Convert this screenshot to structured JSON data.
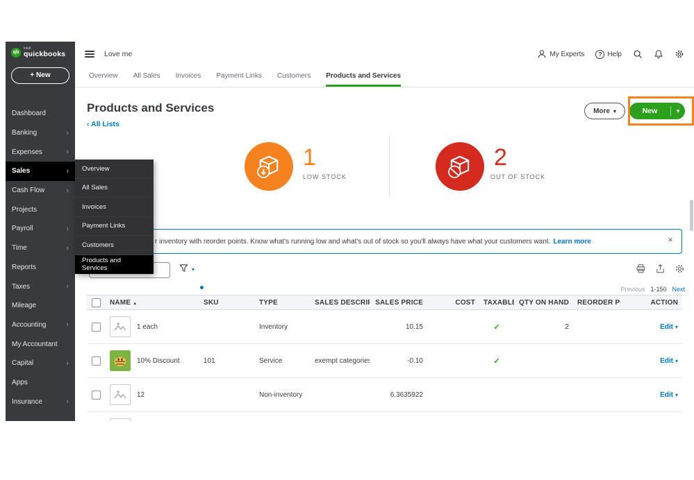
{
  "icons": {
    "chevron_right": "›",
    "back_chevron": "‹",
    "caret_down": "▾",
    "sort_asc": "▲",
    "check": "✓",
    "close": "×",
    "plus": "+"
  },
  "brand": {
    "logo_intuit": "intuit",
    "logo_name": "quickbooks",
    "logo_initials": "qb",
    "green": "#2CA01C"
  },
  "topbar": {
    "company": "Love me",
    "my_experts": "My Experts",
    "help": "Help"
  },
  "sidebar": {
    "new_button": "New",
    "items": [
      {
        "label": "Dashboard",
        "chevron": false,
        "active": false
      },
      {
        "label": "Banking",
        "chevron": true,
        "active": false
      },
      {
        "label": "Expenses",
        "chevron": true,
        "active": false
      },
      {
        "label": "Sales",
        "chevron": true,
        "active": true
      },
      {
        "label": "Cash Flow",
        "chevron": true,
        "active": false
      },
      {
        "label": "Projects",
        "chevron": false,
        "active": false
      },
      {
        "label": "Payroll",
        "chevron": true,
        "active": false
      },
      {
        "label": "Time",
        "chevron": true,
        "active": false
      },
      {
        "label": "Reports",
        "chevron": false,
        "active": false
      },
      {
        "label": "Taxes",
        "chevron": true,
        "active": false
      },
      {
        "label": "Mileage",
        "chevron": false,
        "active": false
      },
      {
        "label": "Accounting",
        "chevron": true,
        "active": false
      },
      {
        "label": "My Accountant",
        "chevron": false,
        "active": false
      },
      {
        "label": "Capital",
        "chevron": true,
        "active": false
      },
      {
        "label": "Apps",
        "chevron": false,
        "active": false
      },
      {
        "label": "Insurance",
        "chevron": true,
        "active": false
      }
    ]
  },
  "flyout": {
    "items": [
      {
        "label": "Overview",
        "active": false
      },
      {
        "label": "All Sales",
        "active": false
      },
      {
        "label": "Invoices",
        "active": false
      },
      {
        "label": "Payment Links",
        "active": false
      },
      {
        "label": "Customers",
        "active": false
      },
      {
        "label": "Products and Services",
        "active": true
      }
    ]
  },
  "tabs": [
    {
      "label": "Overview",
      "active": false
    },
    {
      "label": "All Sales",
      "active": false
    },
    {
      "label": "Invoices",
      "active": false
    },
    {
      "label": "Payment Links",
      "active": false
    },
    {
      "label": "Customers",
      "active": false
    },
    {
      "label": "Products and Services",
      "active": true
    }
  ],
  "page": {
    "title": "Products and Services",
    "back_link": "All Lists",
    "more_button": "More",
    "new_button": "New"
  },
  "stats": [
    {
      "value": "1",
      "label": "LOW STOCK",
      "color": "#F6821F"
    },
    {
      "value": "2",
      "label": "OUT OF STOCK",
      "color": "#D52B1E"
    }
  ],
  "banner": {
    "text": "r inventory with reorder points. Know what's running low and what's out of stock so you'll always have what your customers want.",
    "link": "Learn more"
  },
  "search": {
    "value": ""
  },
  "pagination": {
    "previous": "Previous",
    "range": "1-150",
    "next": "Next"
  },
  "table": {
    "columns": [
      "NAME",
      "SKU",
      "TYPE",
      "SALES DESCRIPTION",
      "SALES PRICE",
      "COST",
      "TAXABLE",
      "QTY ON HAND",
      "REORDER POINT",
      "ACTION"
    ],
    "rows": [
      {
        "name": "1 each",
        "sku": "",
        "type": "Inventory",
        "sales_description": "",
        "sales_price": "10.15",
        "cost": "",
        "taxable": true,
        "qty_on_hand": "2",
        "reorder_point": "",
        "action": "Edit",
        "thumb": "placeholder"
      },
      {
        "name": "10% Discount",
        "sku": "101",
        "type": "Service",
        "sales_description": "exempt categories",
        "sales_price": "-0.10",
        "cost": "",
        "taxable": true,
        "qty_on_hand": "",
        "reorder_point": "",
        "action": "Edit",
        "thumb": "emoji"
      },
      {
        "name": "12",
        "sku": "",
        "type": "Non-inventory",
        "sales_description": "",
        "sales_price": "6.3635922",
        "cost": "",
        "taxable": false,
        "qty_on_hand": "",
        "reorder_point": "",
        "action": "Edit",
        "thumb": "placeholder"
      },
      {
        "name": "",
        "sku": "",
        "type": "",
        "sales_description": "",
        "sales_price": "",
        "cost": "",
        "taxable": false,
        "qty_on_hand": "",
        "reorder_point": "",
        "action": "",
        "thumb": "placeholder"
      }
    ]
  }
}
